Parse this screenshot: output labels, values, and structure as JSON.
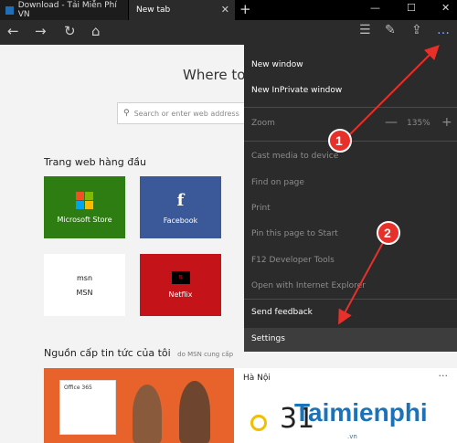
{
  "tabs": [
    {
      "title": "Download - Tải Miễn Phí VN"
    },
    {
      "title": "New tab"
    }
  ],
  "window": {
    "new_tab": "+",
    "minimize": "—",
    "maximize": "☐",
    "close": "✕"
  },
  "nav": {
    "back": "←",
    "forward": "→",
    "refresh": "↻",
    "home": "⌂",
    "more": "…"
  },
  "content": {
    "heading": "Where to",
    "search_placeholder": "Search or enter web address",
    "top_sites_title": "Trang web hàng đầu",
    "tiles": [
      {
        "label": "Microsoft Store",
        "color": "#2e7d12"
      },
      {
        "label": "Facebook",
        "color": "#3b5998"
      },
      {
        "label": "MSN",
        "color": "#ffffff"
      },
      {
        "label": "Netflix",
        "color": "#c4141a"
      }
    ],
    "msn_logo": "msn",
    "news_title": "Nguồn cấp tin tức của tôi",
    "news_sub": "do MSN cung cấp",
    "news_box": "Office 365",
    "weather_city": "Hà Nội",
    "weather_more": "···",
    "weather_temp": "31"
  },
  "menu": {
    "items": [
      {
        "label": "New window",
        "enabled": true
      },
      {
        "label": "New InPrivate window",
        "enabled": true
      },
      {
        "label": "Cast media to device",
        "enabled": false
      },
      {
        "label": "Find on page",
        "enabled": false
      },
      {
        "label": "Print",
        "enabled": false
      },
      {
        "label": "Pin this page to Start",
        "enabled": false
      },
      {
        "label": "F12 Developer Tools",
        "enabled": false
      },
      {
        "label": "Open with Internet Explorer",
        "enabled": false
      },
      {
        "label": "Send feedback",
        "enabled": true
      }
    ],
    "zoom_label": "Zoom",
    "zoom_minus": "—",
    "zoom_value": "135%",
    "zoom_plus": "+",
    "settings_label": "Settings"
  },
  "annotations": {
    "badge1": "1",
    "badge2": "2",
    "color": "#e8302a"
  },
  "watermark": {
    "brand": "Taimienphi",
    "sub": ".vn"
  }
}
